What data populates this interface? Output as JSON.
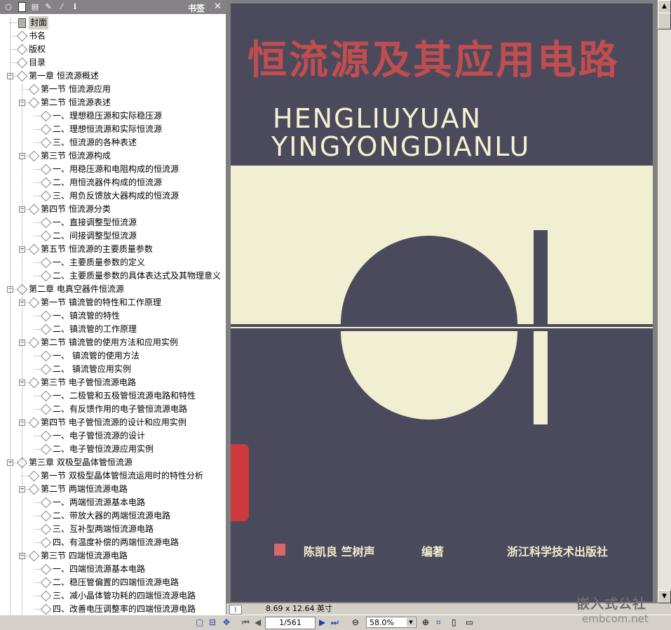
{
  "sidebar": {
    "title": "书签",
    "close_glyph": "✕",
    "toolbar_icons": [
      "options-icon",
      "new-bookmark-icon",
      "page-icon",
      "edit-icon",
      "pen-icon",
      "properties-icon"
    ],
    "items": [
      {
        "level": 0,
        "label": "封面",
        "expand": "",
        "selected": true
      },
      {
        "level": 0,
        "label": "书名",
        "expand": ""
      },
      {
        "level": 0,
        "label": "版权",
        "expand": ""
      },
      {
        "level": 0,
        "label": "目录",
        "expand": ""
      },
      {
        "level": 0,
        "label": "第一章  恒流源概述",
        "expand": "−"
      },
      {
        "level": 1,
        "label": "第一节  恒流源应用",
        "expand": ""
      },
      {
        "level": 1,
        "label": "第二节  恒流源表述",
        "expand": "−"
      },
      {
        "level": 2,
        "label": "一、理想稳压源和实际稳压源",
        "expand": ""
      },
      {
        "level": 2,
        "label": "二、理想恒流源和实际恒流源",
        "expand": ""
      },
      {
        "level": 2,
        "label": "三、恒流源的各种表述",
        "expand": ""
      },
      {
        "level": 1,
        "label": "第三节  恒流源构成",
        "expand": "−"
      },
      {
        "level": 2,
        "label": "一、用稳压源和电阻构成的恒流源",
        "expand": ""
      },
      {
        "level": 2,
        "label": "二、用恒流器件构成的恒流源",
        "expand": ""
      },
      {
        "level": 2,
        "label": "三、用负反馈放大器构成的恒流源",
        "expand": ""
      },
      {
        "level": 1,
        "label": "第四节  恒流源分类",
        "expand": "−"
      },
      {
        "level": 2,
        "label": "一、直接调整型恒流源",
        "expand": ""
      },
      {
        "level": 2,
        "label": "二、间接调整型恒流源",
        "expand": ""
      },
      {
        "level": 1,
        "label": "第五节  恒流源的主要质量参数",
        "expand": "−"
      },
      {
        "level": 2,
        "label": "一、主要质量参数的定义",
        "expand": ""
      },
      {
        "level": 2,
        "label": "二、主要质量参数的具体表达式及其物理意义",
        "expand": ""
      },
      {
        "level": 0,
        "label": "第二章  电真空器件恒流源",
        "expand": "−"
      },
      {
        "level": 1,
        "label": "第一节  镇流管的特性和工作原理",
        "expand": "−"
      },
      {
        "level": 2,
        "label": "一、镇流管的特性",
        "expand": ""
      },
      {
        "level": 2,
        "label": "二、镇流管的工作原理",
        "expand": ""
      },
      {
        "level": 1,
        "label": "第二节  镇流管的使用方法和应用实例",
        "expand": "−"
      },
      {
        "level": 2,
        "label": "一、  镇流管的使用方法",
        "expand": ""
      },
      {
        "level": 2,
        "label": "二、  镇流管应用实例",
        "expand": ""
      },
      {
        "level": 1,
        "label": "第三节  电子管恒流源电路",
        "expand": "−"
      },
      {
        "level": 2,
        "label": "一、二极管和五极管恒流源电路和特性",
        "expand": ""
      },
      {
        "level": 2,
        "label": "二、有反馈作用的电子管恒流源电路",
        "expand": ""
      },
      {
        "level": 1,
        "label": "第四节  电子管恒流源的设计和应用实例",
        "expand": "−"
      },
      {
        "level": 2,
        "label": "一、电子管恒流源的设计",
        "expand": ""
      },
      {
        "level": 2,
        "label": "二、电子管恒流源应用实例",
        "expand": ""
      },
      {
        "level": 0,
        "label": "第三章  双极型晶体管恒流源",
        "expand": "−"
      },
      {
        "level": 1,
        "label": "第一节  双极型晶体管恒流运用时的特性分析",
        "expand": ""
      },
      {
        "level": 1,
        "label": "第二节  两端恒流源电路",
        "expand": "−"
      },
      {
        "level": 2,
        "label": "一、两端恒流源基本电路",
        "expand": ""
      },
      {
        "level": 2,
        "label": "二、带放大器的两端恒流源电路",
        "expand": ""
      },
      {
        "level": 2,
        "label": "三、互补型两端恒流源电路",
        "expand": ""
      },
      {
        "level": 2,
        "label": "四、有温度补偿的两端恒流源电路",
        "expand": ""
      },
      {
        "level": 1,
        "label": "第三节  四端恒流源电路",
        "expand": "−"
      },
      {
        "level": 2,
        "label": "一、四端恒流源基本电路",
        "expand": ""
      },
      {
        "level": 2,
        "label": "二、稳压管偏置的四端恒流源电路",
        "expand": ""
      },
      {
        "level": 2,
        "label": "三、减小晶体管功耗的四端恒流源电路",
        "expand": ""
      },
      {
        "level": 2,
        "label": "四、改善电压调整率的四端恒流源电路",
        "expand": ""
      }
    ]
  },
  "cover": {
    "title": "恒流源及其应用电路",
    "pinyin_line1": "HENGLIUYUAN",
    "pinyin_line2": "YINGYONGDIANLU",
    "authors": "陈凯良    竺树声",
    "role": "编著",
    "publisher": "浙江科学技术出版社",
    "colors": {
      "background": "#4b4a5d",
      "title": "#c14d4f",
      "cream": "#f1efd2",
      "accent": "#d6686a"
    }
  },
  "viewer": {
    "page_size": "8.69 x 12.64 英寸",
    "page_indicator": "1/561",
    "zoom": "58.0%",
    "hbar_nav_glyph": "|◀▶|"
  },
  "watermark": {
    "line1": "嵌入式公社",
    "line2": "embcom.net"
  }
}
